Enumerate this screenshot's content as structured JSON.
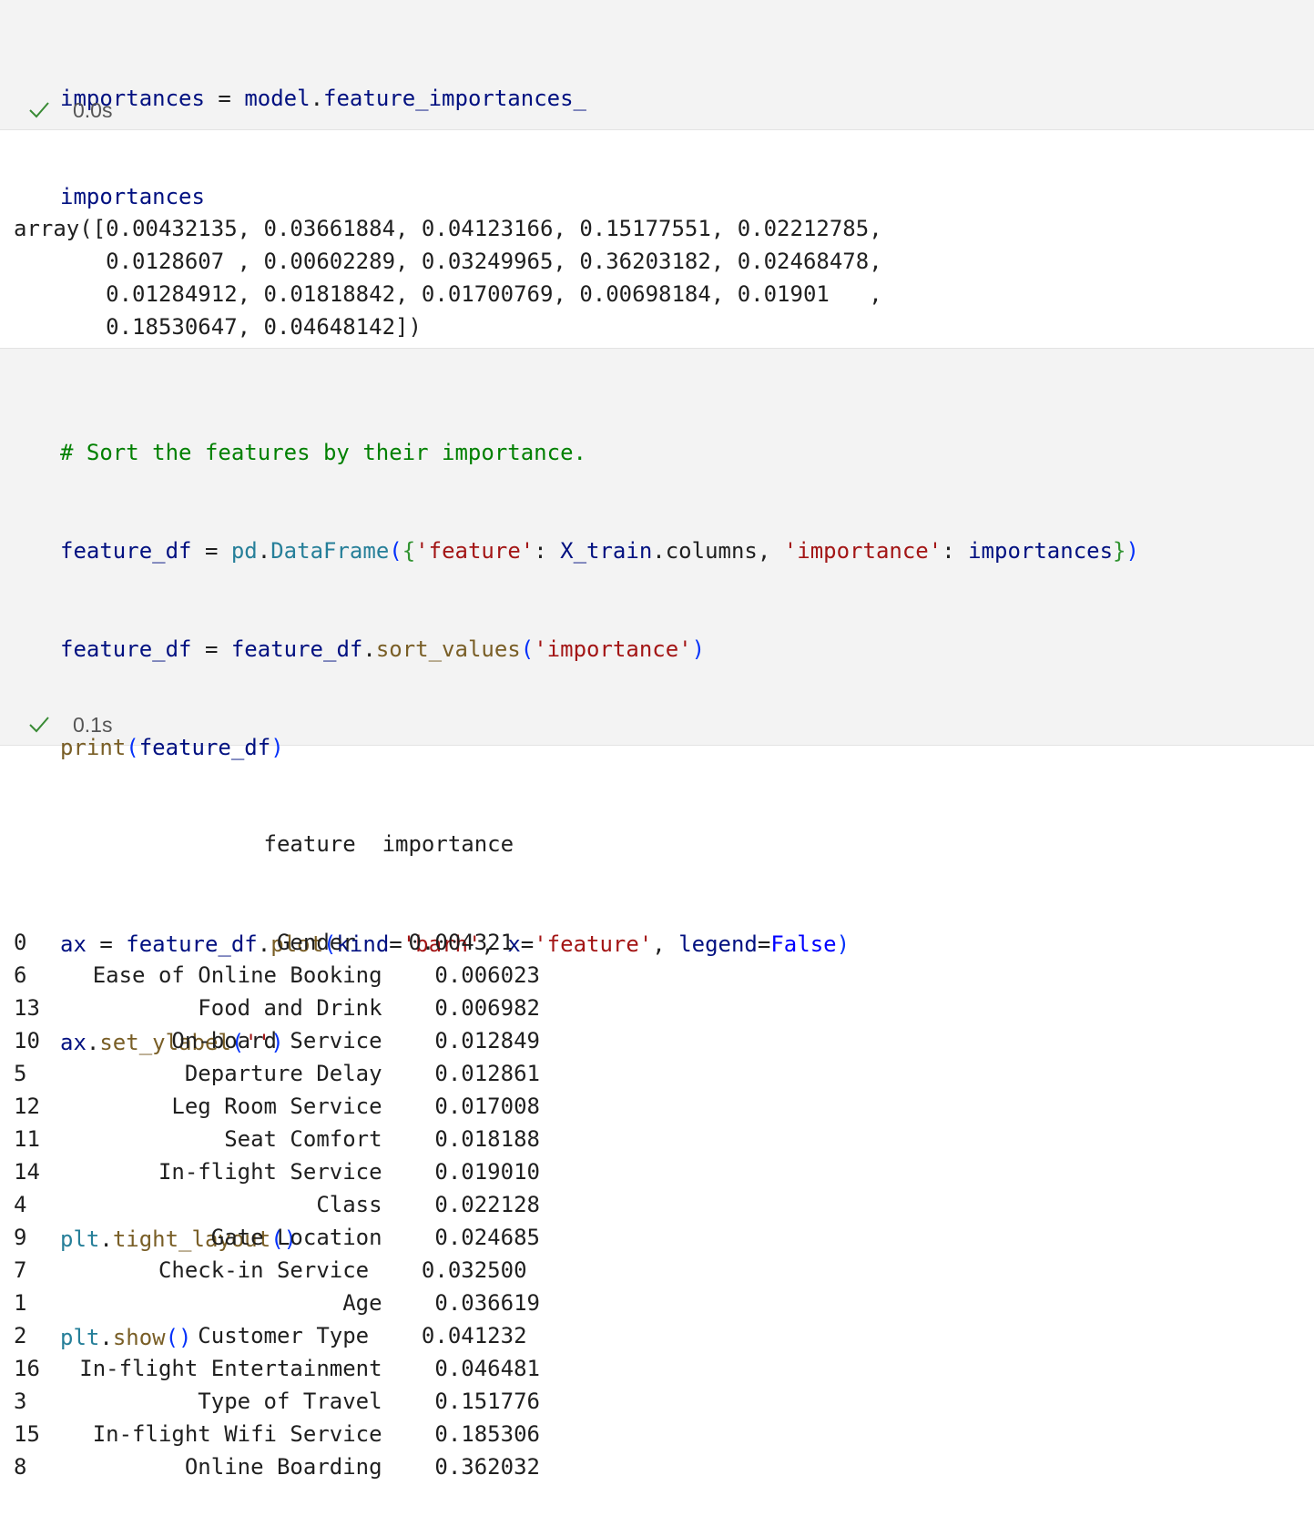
{
  "cell1": {
    "code_line1": {
      "t1": "importances",
      "t2": " = ",
      "t3": "model",
      "t4": ".",
      "t5": "feature_importances_"
    },
    "code_line2": "importances",
    "status_time": "0.0s",
    "output_lines": [
      "array([0.00432135, 0.03661884, 0.04123166, 0.15177551, 0.02212785,",
      "       0.0128607 , 0.00602289, 0.03249965, 0.36203182, 0.02468478,",
      "       0.01284912, 0.01818842, 0.01700769, 0.00698184, 0.01901   ,",
      "       0.18530647, 0.04648142])"
    ]
  },
  "cell2": {
    "comment": "# Sort the features by their importance.",
    "line2": {
      "a": "feature_df",
      "b": " = ",
      "c": "pd",
      "d": ".",
      "e": "DataFrame",
      "f": "(",
      "g": "{",
      "h": "'feature'",
      "i": ": ",
      "j": "X_train",
      "k": ".",
      "l": "columns",
      "m": ", ",
      "n": "'importance'",
      "o": ": ",
      "p": "importances",
      "q": "}",
      "r": ")"
    },
    "line3": {
      "a": "feature_df",
      "b": " = ",
      "c": "feature_df",
      "d": ".",
      "e": "sort_values",
      "f": "(",
      "g": "'importance'",
      "h": ")"
    },
    "line4": {
      "a": "print",
      "b": "(",
      "c": "feature_df",
      "d": ")"
    },
    "line6": {
      "a": "ax",
      "b": " = ",
      "c": "feature_df",
      "d": ".",
      "e": "plot",
      "f": "(",
      "g": "kind",
      "h": "=",
      "i": "'barh'",
      "j": ", ",
      "k": "x",
      "l": "=",
      "m": "'feature'",
      "n": ", ",
      "o": "legend",
      "p": "=",
      "q": "False",
      "r": ")"
    },
    "line7": {
      "a": "ax",
      "b": ".",
      "c": "set_ylabel",
      "d": "(",
      "e": "''",
      "f": ")"
    },
    "line9": {
      "a": "plt",
      "b": ".",
      "c": "tight_layout",
      "d": "()"
    },
    "line10": {
      "a": "plt",
      "b": ".",
      "c": "show",
      "d": "()"
    },
    "status_time": "0.1s",
    "table_header": "                   feature  importance",
    "table_rows": [
      "0                   Gender    0.004321",
      "6     Ease of Online Booking    0.006023",
      "13            Food and Drink    0.006982",
      "10          On-board Service    0.012849",
      "5            Departure Delay    0.012861",
      "12          Leg Room Service    0.017008",
      "11              Seat Comfort    0.018188",
      "14         In-flight Service    0.019010",
      "4                      Class    0.022128",
      "9              Gate Location    0.024685",
      "7          Check-in Service    0.032500",
      "1                        Age    0.036619",
      "2             Customer Type    0.041232",
      "16   In-flight Entertainment    0.046481",
      "3             Type of Travel    0.151776",
      "15    In-flight Wifi Service    0.185306",
      "8            Online Boarding    0.362032"
    ]
  }
}
